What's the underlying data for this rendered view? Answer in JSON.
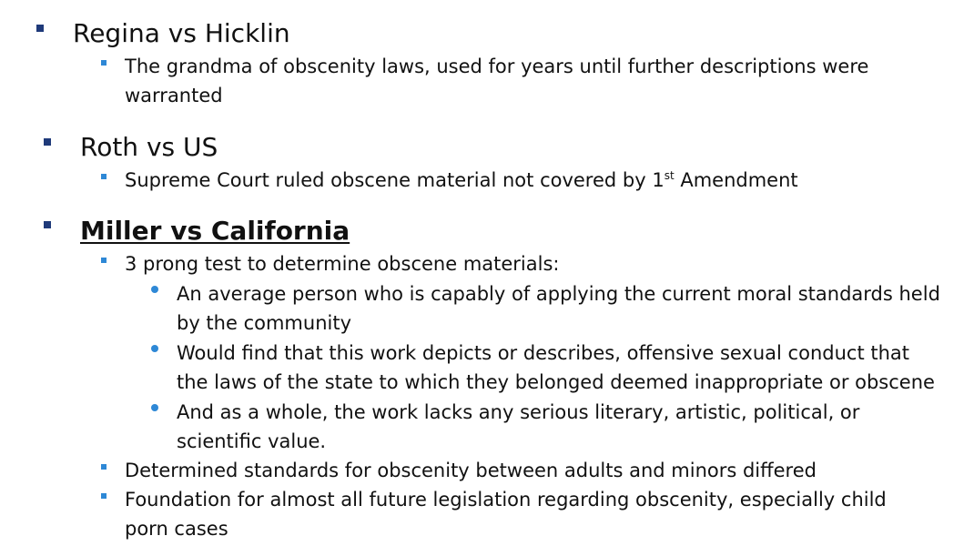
{
  "slide": {
    "colors": {
      "primary_bullet": "#1f3a7a",
      "secondary_bullet": "#2e88d6",
      "text": "#111111"
    },
    "sections": [
      {
        "heading": "Regina vs Hicklin",
        "points": [
          "The grandma of obscenity laws, used for years until further descriptions were warranted"
        ]
      },
      {
        "heading": "Roth vs US",
        "points": [
          {
            "before": "Supreme Court ruled obscene material not covered by 1",
            "superscript": "st",
            "after": " Amendment"
          }
        ]
      },
      {
        "heading": "Miller vs California",
        "points": [
          {
            "text": "3 prong test to determine obscene materials:",
            "subpoints": [
              "An average person who is capably of applying the current moral standards held by the community",
              "Would find that this work depicts or describes, offensive sexual conduct that the laws of the state to which they belonged deemed inappropriate or obscene",
              "And as a whole, the work lacks any serious literary, artistic, political, or scientific value."
            ]
          },
          "Determined standards for obscenity between adults and minors differed",
          "Foundation for almost all future legislation regarding obscenity, especially child porn cases"
        ]
      }
    ]
  }
}
